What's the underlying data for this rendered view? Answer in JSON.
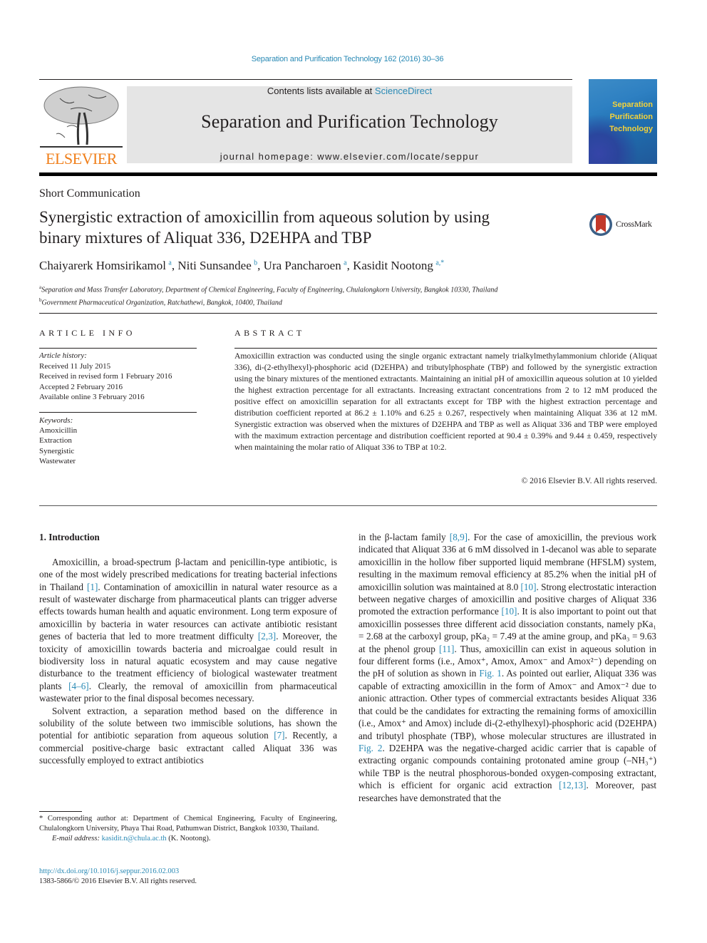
{
  "header": {
    "journal_ref": "Separation and Purification Technology 162 (2016) 30–36",
    "contents_prefix": "Contents lists available at ",
    "contents_link": "ScienceDirect",
    "journal_title": "Separation and Purification Technology",
    "homepage": "journal homepage: www.elsevier.com/locate/seppur",
    "publisher_logo_text": "ELSEVIER",
    "cover_title_lines": [
      "Separation",
      "Purification",
      "Technology"
    ]
  },
  "article": {
    "type": "Short Communication",
    "title_line1": "Synergistic extraction of amoxicillin from aqueous solution by using",
    "title_line2": "binary mixtures of Aliquat 336, D2EHPA and TBP",
    "crossmark_label": "CrossMark",
    "authors": [
      {
        "name": "Chaiyarerk Homsirikamol",
        "sup": "a"
      },
      {
        "name": "Niti Sunsandee",
        "sup": "b"
      },
      {
        "name": "Ura Pancharoen",
        "sup": "a"
      },
      {
        "name": "Kasidit Nootong",
        "sup": "a,*"
      }
    ],
    "affiliations": [
      {
        "sup": "a",
        "text": "Separation and Mass Transfer Laboratory, Department of Chemical Engineering, Faculty of Engineering, Chulalongkorn University, Bangkok 10330, Thailand"
      },
      {
        "sup": "b",
        "text": "Government Pharmaceutical Organization, Ratchathewi, Bangkok, 10400, Thailand"
      }
    ]
  },
  "article_info": {
    "heading": "ARTICLE INFO",
    "history_label": "Article history:",
    "history": [
      "Received 11 July 2015",
      "Received in revised form 1 February 2016",
      "Accepted 2 February 2016",
      "Available online 3 February 2016"
    ],
    "keywords_label": "Keywords:",
    "keywords": [
      "Amoxicillin",
      "Extraction",
      "Synergistic",
      "Wastewater"
    ]
  },
  "abstract": {
    "heading": "ABSTRACT",
    "text": "Amoxicillin extraction was conducted using the single organic extractant namely trialkylmethylammonium chloride (Aliquat 336), di-(2-ethylhexyl)-phosphoric acid (D2EHPA) and tributylphosphate (TBP) and followed by the synergistic extraction using the binary mixtures of the mentioned extractants. Maintaining an initial pH of amoxicillin aqueous solution at 10 yielded the highest extraction percentage for all extractants. Increasing extractant concentrations from 2 to 12 mM produced the positive effect on amoxicillin separation for all extractants except for TBP with the highest extraction percentage and distribution coefficient reported at 86.2 ± 1.10% and 6.25 ± 0.267, respectively when maintaining Aliquat 336 at 12 mM. Synergistic extraction was observed when the mixtures of D2EHPA and TBP as well as Aliquat 336 and TBP were employed with the maximum extraction percentage and distribution coefficient reported at 90.4 ± 0.39% and 9.44 ± 0.459, respectively when maintaining the molar ratio of Aliquat 336 to TBP at 10:2.",
    "copyright": "© 2016 Elsevier B.V. All rights reserved."
  },
  "body": {
    "section_heading": "1. Introduction",
    "left_p1": [
      {
        "t": "Amoxicillin, a broad-spectrum β-lactam and penicillin-type antibiotic, is one of the most widely prescribed medications for treating bacterial infections in Thailand "
      },
      {
        "ref": "[1]"
      },
      {
        "t": ". Contamination of amoxicillin in natural water resource as a result of wastewater discharge from pharmaceutical plants can trigger adverse effects towards human health and aquatic environment. Long term exposure of amoxicillin by bacteria in water resources can activate antibiotic resistant genes of bacteria that led to more treatment difficulty "
      },
      {
        "ref": "[2,3]"
      },
      {
        "t": ". Moreover, the toxicity of amoxicillin towards bacteria and microalgae could result in biodiversity loss in natural aquatic ecosystem and may cause negative disturbance to the treatment efficiency of biological wastewater treatment plants "
      },
      {
        "ref": "[4–6]"
      },
      {
        "t": ". Clearly, the removal of amoxicillin from pharmaceutical wastewater prior to the final disposal becomes necessary."
      }
    ],
    "left_p2": [
      {
        "t": "Solvent extraction, a separation method based on the difference in solubility of the solute between two immiscible solutions, has shown the potential for antibiotic separation from aqueous solution "
      },
      {
        "ref": "[7]"
      },
      {
        "t": ". Recently, a commercial positive-charge basic extractant called Aliquat 336 was successfully employed to extract antibiotics"
      }
    ],
    "right_p1": [
      {
        "t": "in the β-lactam family "
      },
      {
        "ref": "[8,9]"
      },
      {
        "t": ". For the case of amoxicillin, the previous work indicated that Aliquat 336 at 6 mM dissolved in 1-decanol was able to separate amoxicillin in the hollow fiber supported liquid membrane (HFSLM) system, resulting in the maximum removal efficiency at 85.2% when the initial pH of amoxicillin solution was maintained at 8.0 "
      },
      {
        "ref": "[10]"
      },
      {
        "t": ". Strong electrostatic interaction between negative charges of amoxicillin and positive charges of Aliquat 336 promoted the extraction performance "
      },
      {
        "ref": "[10]"
      },
      {
        "t": ". It is also important to point out that amoxicillin possesses three different acid dissociation constants, namely pKa₁ = 2.68 at the carboxyl group, pKa₂ = 7.49 at the amine group, and pKa₃ = 9.63 at the phenol group "
      },
      {
        "ref": "[11]"
      },
      {
        "t": ". Thus, amoxicillin can exist in aqueous solution in four different forms (i.e., Amox⁺, Amox, Amox⁻ and Amox²⁻) depending on the pH of solution as shown in "
      },
      {
        "ref": "Fig. 1"
      },
      {
        "t": ". As pointed out earlier, Aliquat 336 was capable of extracting amoxicillin in the form of Amox⁻ and Amox⁻² due to anionic attraction. Other types of commercial extractants besides Aliquat 336 that could be the candidates for extracting the remaining forms of amoxicillin (i.e., Amox⁺ and Amox) include di-(2-ethylhexyl)-phosphoric acid (D2EHPA) and tributyl phosphate (TBP), whose molecular structures are illustrated in "
      },
      {
        "ref": "Fig. 2"
      },
      {
        "t": ". D2EHPA was the negative-charged acidic carrier that is capable of extracting organic compounds containing protonated amine group (–NH₃⁺) while TBP is the neutral phosphorous-bonded oxygen-composing extractant, which is efficient for organic acid extraction "
      },
      {
        "ref": "[12,13]"
      },
      {
        "t": ". Moreover, past researches have demonstrated that the"
      }
    ]
  },
  "footnote": {
    "corresponding": "* Corresponding author at: Department of Chemical Engineering, Faculty of Engineering, Chulalongkorn University, Phaya Thai Road, Pathumwan District, Bangkok 10330, Thailand.",
    "email_label": "E-mail address: ",
    "email": "kasidit.n@chula.ac.th",
    "email_suffix": " (K. Nootong).",
    "doi": "http://dx.doi.org/10.1016/j.seppur.2016.02.003",
    "issn_line": "1383-5866/© 2016 Elsevier B.V. All rights reserved."
  },
  "colors": {
    "link": "#2a8ab5",
    "elsevier_orange": "#f07f1a",
    "banner_gray": "#e5e5e5"
  }
}
